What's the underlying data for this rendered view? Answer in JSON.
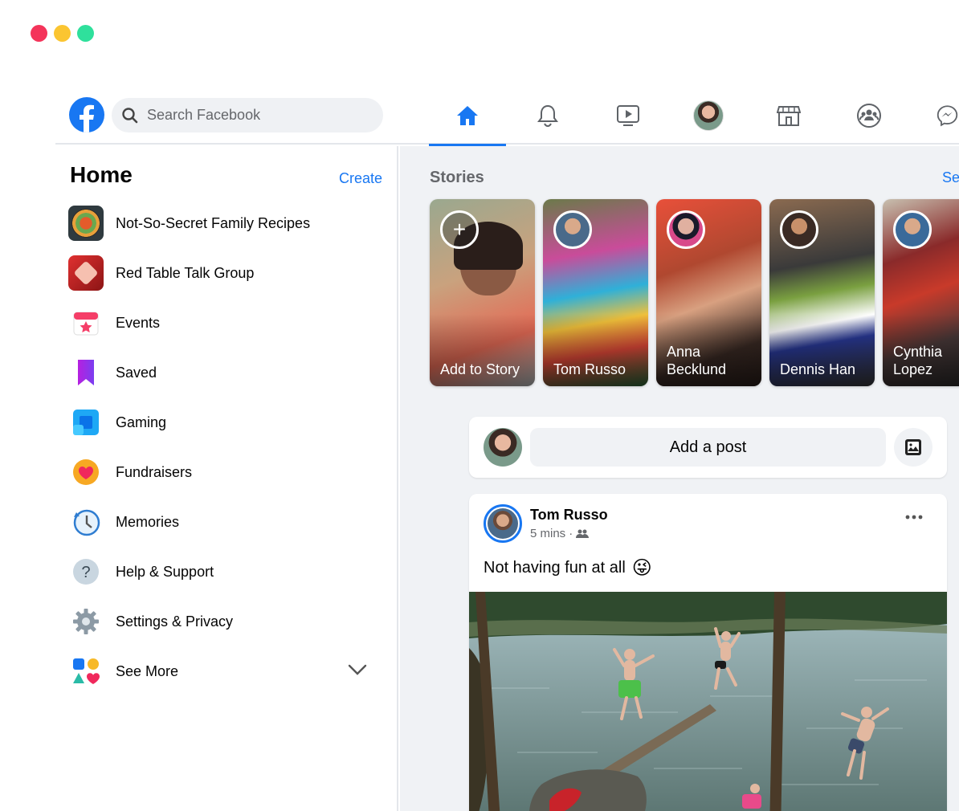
{
  "window": {
    "controls": [
      "close",
      "minimize",
      "maximize"
    ]
  },
  "topbar": {
    "search_placeholder": "Search Facebook",
    "nav": [
      {
        "icon": "home-icon",
        "active": true
      },
      {
        "icon": "bell-icon",
        "active": false
      },
      {
        "icon": "watch-icon",
        "active": false
      },
      {
        "icon": "profile-avatar",
        "active": false
      },
      {
        "icon": "marketplace-icon",
        "active": false
      },
      {
        "icon": "groups-icon",
        "active": false
      },
      {
        "icon": "messenger-icon",
        "active": false
      }
    ],
    "accent": "#1877f2"
  },
  "sidebar": {
    "title": "Home",
    "create_label": "Create",
    "items": [
      {
        "label": "Not-So-Secret Family Recipes",
        "icon": "group-recipes-thumb"
      },
      {
        "label": "Red Table Talk Group",
        "icon": "group-redtable-thumb"
      },
      {
        "label": "Events",
        "icon": "calendar-star-icon"
      },
      {
        "label": "Saved",
        "icon": "bookmark-icon"
      },
      {
        "label": "Gaming",
        "icon": "gaming-icon"
      },
      {
        "label": "Fundraisers",
        "icon": "heart-icon"
      },
      {
        "label": "Memories",
        "icon": "clock-icon"
      },
      {
        "label": "Help & Support",
        "icon": "help-icon"
      },
      {
        "label": "Settings & Privacy",
        "icon": "gear-icon"
      },
      {
        "label": "See More",
        "icon": "shapes-icon"
      }
    ]
  },
  "stories": {
    "title": "Stories",
    "see_all_label": "Se",
    "items": [
      {
        "name": "Add to Story"
      },
      {
        "name": "Tom Russo"
      },
      {
        "name": "Anna Becklund"
      },
      {
        "name": "Dennis Han"
      },
      {
        "name": "Cynthia Lopez"
      }
    ]
  },
  "composer": {
    "placeholder": "Add a post"
  },
  "post": {
    "author": "Tom Russo",
    "time": "5 mins",
    "separator": "·",
    "audience_icon": "friends-icon",
    "text": "Not having fun at all",
    "emoji": "😜"
  }
}
